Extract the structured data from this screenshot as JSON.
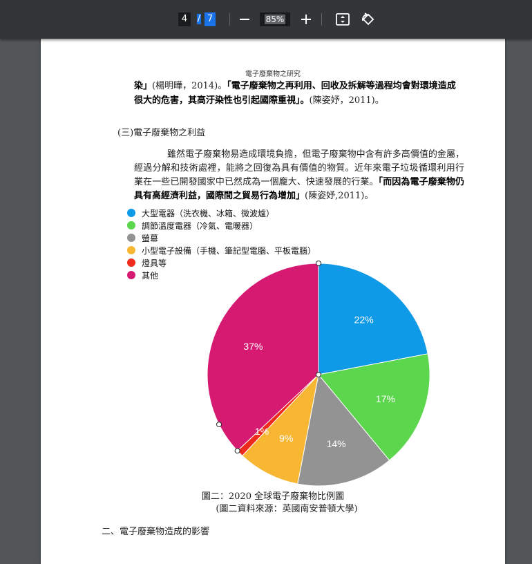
{
  "toolbar": {
    "current_page": "4",
    "separator": "/",
    "total_pages": "7",
    "zoom": "85%",
    "icons": [
      "minus-icon",
      "plus-icon",
      "fit-page-icon",
      "rotate-icon"
    ]
  },
  "page": {
    "header": "電子廢棄物之研究",
    "cont_bold_1": "染」",
    "cont_cite_1": "(楊明曄，2014)。",
    "cont_bold_2": "「電子廢棄物之再利用、回收及拆解等過程均會對環境造成很大的危害，其高汙染性也引起國際重視」。",
    "cont_cite_2": "(陳姿妤，2011)。",
    "section_title": "(三)電子廢棄物之利益",
    "para_text": "雖然電子廢棄物易造成環境負擔，但電子廢棄物中含有許多高價值的金屬，經過分解和技術處裡，能將之回復為具有價值的物質。近年來電子垃圾循環利用行業在一些已開發國家中已然成為一個龐大、快速發展的行業。",
    "para_bold": "「而因為電子廢棄物仍具有高經濟利益，國際間之貿易行為增加」",
    "para_cite": "(陳姿妤,2011)。",
    "caption1": "圖二：2020 全球電子廢棄物比例圖",
    "caption2": "(圖二資料來源：英國南安普頓大學)",
    "next_line": "二、電子廢棄物造成的影響"
  },
  "chart_data": {
    "type": "pie",
    "start_angle_deg": 0,
    "direction": "clockwise",
    "slices": [
      {
        "label": "大型電器（洗衣機、冰箱、微波爐）",
        "value": 22,
        "text": "22%",
        "color": "#0f9ae8"
      },
      {
        "label": "調節溫度電器（冷氣、電暖器）",
        "value": 17,
        "text": "17%",
        "color": "#5cd64c"
      },
      {
        "label": "螢幕",
        "value": 14,
        "text": "14%",
        "color": "#939393"
      },
      {
        "label": "小型電子設備（手機、筆記型電腦、平板電腦）",
        "value": 9,
        "text": "9%",
        "color": "#f8b732"
      },
      {
        "label": "燈具等",
        "value": 1,
        "text": "1%",
        "color": "#f02a1c"
      },
      {
        "label": "其他",
        "value": 37,
        "text": "37%",
        "color": "#d61a72"
      }
    ]
  }
}
